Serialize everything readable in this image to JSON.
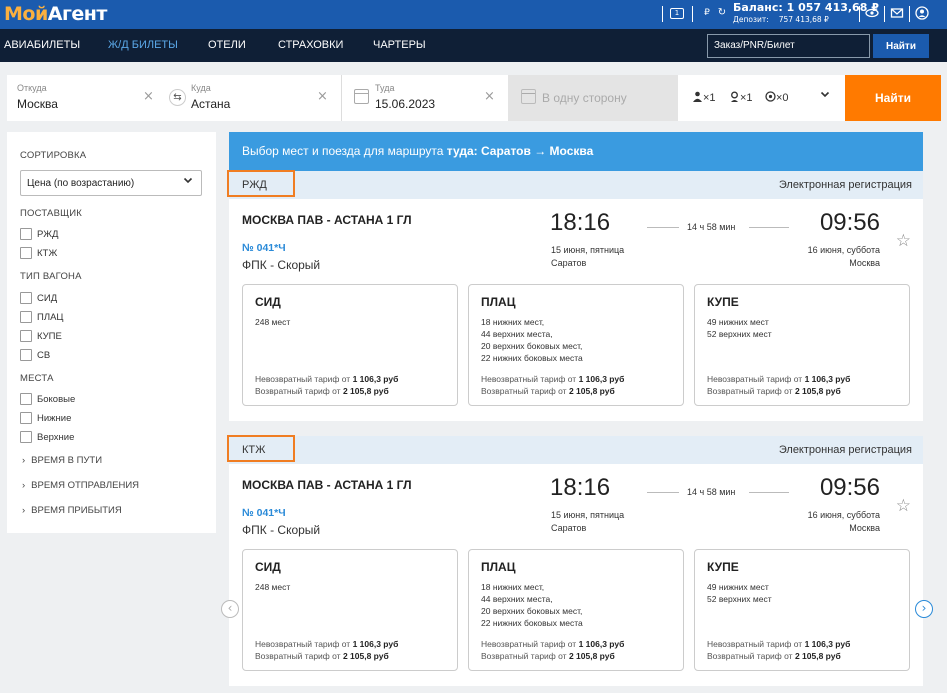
{
  "brand": {
    "logo_pre": "Мой",
    "logo_post": "Агент"
  },
  "header": {
    "balance": "Баланс: 1 057 413,68 ₽",
    "deposit_label": "Депозит:",
    "deposit_value": "757 413,68 ₽"
  },
  "nav": {
    "items": [
      "АВИАБИЛЕТЫ",
      "Ж/Д БИЛЕТЫ",
      "ОТЕЛИ",
      "СТРАХОВКИ",
      "ЧАРТЕРЫ"
    ],
    "active": 1,
    "order_placeholder": "Заказ/PNR/Билет",
    "find": "Найти"
  },
  "search": {
    "from_label": "Откуда",
    "from_value": "Москва",
    "to_label": "Куда",
    "to_value": "Астана",
    "date_label": "Туда",
    "date_value": "15.06.2023",
    "oneway": "В одну сторону",
    "adults": "×1",
    "children": "×1",
    "infants": "×0",
    "find": "Найти"
  },
  "sidebar": {
    "sort_head": "СОРТИРОВКА",
    "sort_value": "Цена (по возрастанию)",
    "supplier_head": "ПОСТАВЩИК",
    "suppliers": [
      "РЖД",
      "КТЖ"
    ],
    "wagon_head": "ТИП ВАГОНА",
    "wagons": [
      "СИД",
      "ПЛАЦ",
      "КУПЕ",
      "СВ"
    ],
    "places_head": "МЕСТА",
    "places": [
      "Боковые",
      "Нижние",
      "Верхние"
    ],
    "accordions": [
      "ВРЕМЯ В ПУТИ",
      "ВРЕМЯ ОТПРАВЛЕНИЯ",
      "ВРЕМЯ ПРИБЫТИЯ"
    ]
  },
  "banner": {
    "text": "Выбор мест и поезда для маршрута",
    "route": "туда: Саратов  →  Москва"
  },
  "cards": [
    {
      "supplier": "РЖД",
      "ereg": "Электронная регистрация",
      "route": "МОСКВА ПАВ - АСТАНА 1 ГЛ",
      "train_no": "№ 041*Ч",
      "train_type": "ФПК - Скорый",
      "dep_time": "18:16",
      "dep_date": "15 июня, пятница",
      "dep_city": "Саратов",
      "duration": "14 ч 58 мин",
      "arr_time": "09:56",
      "arr_date": "16 июня, суббота",
      "arr_city": "Москва",
      "seats": [
        {
          "title": "СИД",
          "lines": [
            "248 мест"
          ],
          "nonrefund": "Невозвратный тариф от ",
          "nonrefund_price": "1 106,3 руб",
          "refund": "Возвратный тариф от ",
          "refund_price": "2 105,8 руб"
        },
        {
          "title": "ПЛАЦ",
          "lines": [
            "18 нижних мест,",
            "44 верхних места,",
            "20 верхних боковых мест,",
            "22 нижних боковых места"
          ],
          "nonrefund": "Невозвратный тариф от ",
          "nonrefund_price": "1 106,3 руб",
          "refund": "Возвратный тариф от ",
          "refund_price": "2 105,8 руб"
        },
        {
          "title": "КУПЕ",
          "lines": [
            "49 нижних мест",
            "52 верхних мест"
          ],
          "nonrefund": "Невозвратный тариф от ",
          "nonrefund_price": "1 106,3 руб",
          "refund": "Возвратный тариф от ",
          "refund_price": "2 105,8 руб"
        }
      ]
    },
    {
      "supplier": "КТЖ",
      "ereg": "Электронная регистрация",
      "route": "МОСКВА ПАВ - АСТАНА 1 ГЛ",
      "train_no": "№ 041*Ч",
      "train_type": "ФПК - Скорый",
      "dep_time": "18:16",
      "dep_date": "15 июня, пятница",
      "dep_city": "Саратов",
      "duration": "14 ч 58 мин",
      "arr_time": "09:56",
      "arr_date": "16 июня, суббота",
      "arr_city": "Москва",
      "seats": [
        {
          "title": "СИД",
          "lines": [
            "248 мест"
          ],
          "nonrefund": "Невозвратный тариф от ",
          "nonrefund_price": "1 106,3 руб",
          "refund": "Возвратный тариф от ",
          "refund_price": "2 105,8 руб"
        },
        {
          "title": "ПЛАЦ",
          "lines": [
            "18 нижних мест,",
            "44 верхних места,",
            "20 верхних боковых мест,",
            "22 нижних боковых места"
          ],
          "nonrefund": "Невозвратный тариф от ",
          "nonrefund_price": "1 106,3 руб",
          "refund": "Возвратный тариф от ",
          "refund_price": "2 105,8 руб"
        },
        {
          "title": "КУПЕ",
          "lines": [
            "49 нижних мест",
            "52 верхних мест"
          ],
          "nonrefund": "Невозвратный тариф от ",
          "nonrefund_price": "1 106,3 руб",
          "refund": "Возвратный тариф от ",
          "refund_price": "2 105,8 руб"
        }
      ]
    }
  ],
  "colors": {
    "brand_blue": "#1b5bae",
    "nav_dark": "#0f1f36",
    "accent_orange": "#ff7a00",
    "banner_blue": "#3a9be0",
    "highlight_box": "#f07d22"
  }
}
